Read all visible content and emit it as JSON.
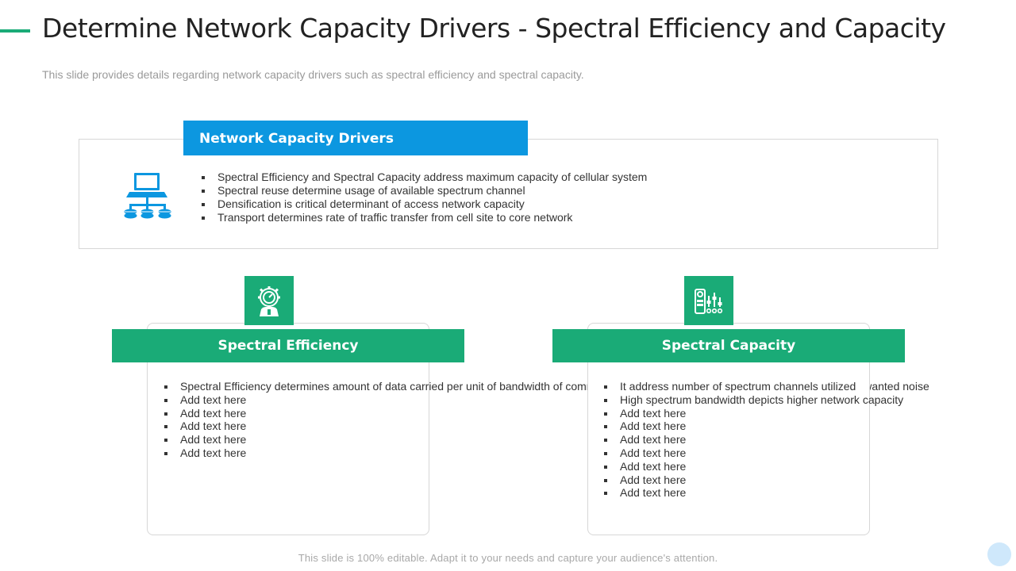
{
  "header": {
    "title": "Determine Network Capacity Drivers - Spectral Efficiency and Capacity",
    "subtitle": "This slide provides details regarding network capacity drivers such as spectral efficiency and spectral capacity."
  },
  "drivers": {
    "heading": "Network Capacity Drivers",
    "icon": "network-computer-icon",
    "items": [
      "Spectral Efficiency and Spectral Capacity address maximum  capacity of cellular system",
      "Spectral reuse determine usage of available spectrum channel",
      "Densification is critical determinant of access network capacity",
      "Transport determines rate of traffic transfer from cell site to core network"
    ]
  },
  "efficiency": {
    "heading": "Spectral Efficiency",
    "icon": "gauge-gear-person-icon",
    "items": [
      "Spectral Efficiency determines amount of data carried per unit of bandwidth of communication channel at given time the ratio of signal to unwanted noise",
      "Add text here",
      "Add text here",
      "Add text here",
      "Add text here",
      "Add text here"
    ]
  },
  "capacity": {
    "heading": "Spectral Capacity",
    "icon": "control-panel-icon",
    "items": [
      "It address number of spectrum channels utilized",
      "High spectrum bandwidth depicts higher network capacity",
      "Add text here",
      "Add text here",
      "Add text here",
      "Add text here",
      "Add text here",
      "Add text here",
      "Add text here"
    ]
  },
  "footer": {
    "note": "This slide is 100% editable. Adapt it to your needs and capture your audience's attention."
  },
  "colors": {
    "accent_green": "#1aab77",
    "accent_blue": "#0c97e0"
  }
}
